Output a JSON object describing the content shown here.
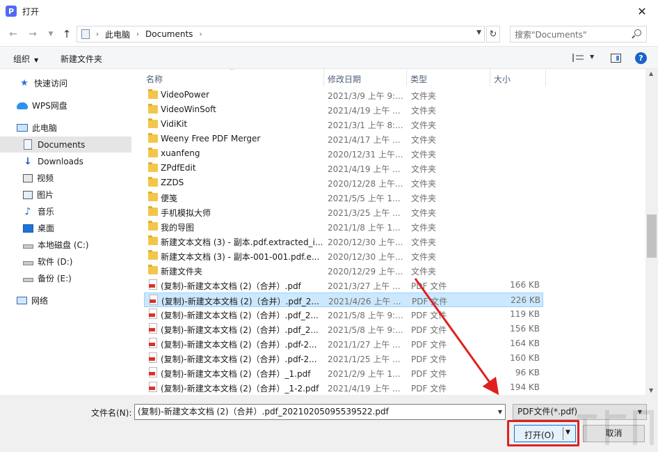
{
  "window": {
    "title": "打开",
    "close_glyph": "✕"
  },
  "address": {
    "crumbs": [
      "此电脑",
      "Documents"
    ],
    "search_placeholder": "搜索\"Documents\""
  },
  "toolbar": {
    "organize": "组织",
    "new_folder": "新建文件夹",
    "help": "?"
  },
  "sidebar": {
    "items": [
      {
        "label": "快速访问",
        "icon": "star-icon"
      },
      {
        "label": "WPS网盘",
        "icon": "cloud-icon"
      },
      {
        "label": "此电脑",
        "icon": "computer-icon"
      },
      {
        "label": "Documents",
        "icon": "documents-icon"
      },
      {
        "label": "Downloads",
        "icon": "download-icon"
      },
      {
        "label": "视频",
        "icon": "video-icon"
      },
      {
        "label": "图片",
        "icon": "picture-icon"
      },
      {
        "label": "音乐",
        "icon": "music-icon"
      },
      {
        "label": "桌面",
        "icon": "desktop-icon"
      },
      {
        "label": "本地磁盘 (C:)",
        "icon": "drive-icon"
      },
      {
        "label": "软件 (D:)",
        "icon": "drive-icon"
      },
      {
        "label": "备份 (E:)",
        "icon": "drive-icon"
      },
      {
        "label": "网络",
        "icon": "network-icon"
      }
    ]
  },
  "columns": {
    "name": "名称",
    "date": "修改日期",
    "type": "类型",
    "size": "大小"
  },
  "files": [
    {
      "name": "VideoPower",
      "date": "2021/3/9 上午 9:...",
      "type": "文件夹",
      "size": "",
      "kind": "folder"
    },
    {
      "name": "VideoWinSoft",
      "date": "2021/4/19 上午 ...",
      "type": "文件夹",
      "size": "",
      "kind": "folder"
    },
    {
      "name": "VidiKit",
      "date": "2021/3/1 上午 8:...",
      "type": "文件夹",
      "size": "",
      "kind": "folder"
    },
    {
      "name": "Weeny Free PDF Merger",
      "date": "2021/4/17 上午 ...",
      "type": "文件夹",
      "size": "",
      "kind": "folder"
    },
    {
      "name": "xuanfeng",
      "date": "2020/12/31 上午...",
      "type": "文件夹",
      "size": "",
      "kind": "folder"
    },
    {
      "name": "ZPdfEdit",
      "date": "2021/4/19 上午 ...",
      "type": "文件夹",
      "size": "",
      "kind": "folder"
    },
    {
      "name": "ZZDS",
      "date": "2020/12/28 上午...",
      "type": "文件夹",
      "size": "",
      "kind": "folder"
    },
    {
      "name": "便笺",
      "date": "2021/5/5 上午 1...",
      "type": "文件夹",
      "size": "",
      "kind": "folder"
    },
    {
      "name": "手机模拟大师",
      "date": "2021/3/25 上午 ...",
      "type": "文件夹",
      "size": "",
      "kind": "folder"
    },
    {
      "name": "我的导图",
      "date": "2021/1/8 上午 1...",
      "type": "文件夹",
      "size": "",
      "kind": "folder"
    },
    {
      "name": "新建文本文档 (3) - 副本.pdf.extracted_i...",
      "date": "2020/12/30 上午...",
      "type": "文件夹",
      "size": "",
      "kind": "folder"
    },
    {
      "name": "新建文本文档 (3) - 副本-001-001.pdf.e...",
      "date": "2020/12/30 上午...",
      "type": "文件夹",
      "size": "",
      "kind": "folder"
    },
    {
      "name": "新建文件夹",
      "date": "2020/12/29 上午...",
      "type": "文件夹",
      "size": "",
      "kind": "folder"
    },
    {
      "name": "(复制)-新建文本文档 (2)（合并）.pdf",
      "date": "2021/3/27 上午 ...",
      "type": "PDF 文件",
      "size": "166 KB",
      "kind": "pdf"
    },
    {
      "name": "(复制)-新建文本文档 (2)（合并）.pdf_2...",
      "date": "2021/4/26 上午 ...",
      "type": "PDF 文件",
      "size": "226 KB",
      "kind": "pdf",
      "selected": true
    },
    {
      "name": "(复制)-新建文本文档 (2)（合并）.pdf_2...",
      "date": "2021/5/8 上午 9:...",
      "type": "PDF 文件",
      "size": "119 KB",
      "kind": "pdf"
    },
    {
      "name": "(复制)-新建文本文档 (2)（合并）.pdf_2...",
      "date": "2021/5/8 上午 9:...",
      "type": "PDF 文件",
      "size": "156 KB",
      "kind": "pdf"
    },
    {
      "name": "(复制)-新建文本文档 (2)（合并）.pdf-2...",
      "date": "2021/1/27 上午 ...",
      "type": "PDF 文件",
      "size": "164 KB",
      "kind": "pdf"
    },
    {
      "name": "(复制)-新建文本文档 (2)（合并）.pdf-2...",
      "date": "2021/1/25 上午 ...",
      "type": "PDF 文件",
      "size": "160 KB",
      "kind": "pdf"
    },
    {
      "name": "(复制)-新建文本文档 (2)（合并）_1.pdf",
      "date": "2021/2/9 上午 1...",
      "type": "PDF 文件",
      "size": "96 KB",
      "kind": "pdf"
    },
    {
      "name": "(复制)-新建文本文档 (2)（合并）_1-2.pdf",
      "date": "2021/4/19 上午 ...",
      "type": "PDF 文件",
      "size": "194 KB",
      "kind": "pdf"
    }
  ],
  "footer": {
    "filename_label": "文件名(N):",
    "filename_value": "(复制)-新建文本文档 (2)（合并）.pdf_20210205095539522.pdf",
    "filetype_value": "PDF文件(*.pdf)",
    "open_label": "打开(O)",
    "cancel_label": "取消"
  },
  "colors": {
    "selection": "#cce8ff",
    "accent": "#0078d7",
    "annotation": "#e02020"
  }
}
